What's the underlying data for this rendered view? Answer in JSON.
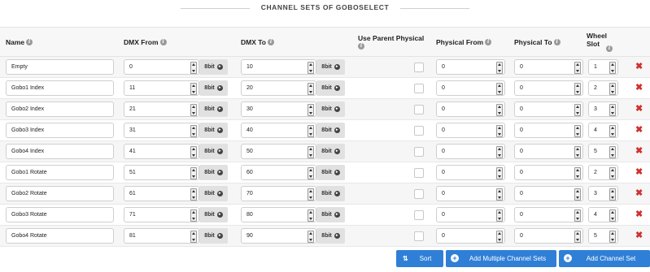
{
  "header": {
    "title": "CHANNEL SETS OF GOBOSELECT"
  },
  "columns": {
    "name": "Name",
    "dmx_from": "DMX From",
    "dmx_to": "DMX To",
    "use_parent_physical": "Use Parent Physical",
    "physical_from": "Physical From",
    "physical_to": "Physical To",
    "wheel_slot": "Wheel Slot"
  },
  "bit_label": "8bit",
  "rows": [
    {
      "name": "Empty",
      "dmx_from": "0",
      "dmx_to": "10",
      "physical_from": "0",
      "physical_to": "0",
      "wheel_slot": "1"
    },
    {
      "name": "Gobo1 Index",
      "dmx_from": "11",
      "dmx_to": "20",
      "physical_from": "0",
      "physical_to": "0",
      "wheel_slot": "2"
    },
    {
      "name": "Gobo2 Index",
      "dmx_from": "21",
      "dmx_to": "30",
      "physical_from": "0",
      "physical_to": "0",
      "wheel_slot": "3"
    },
    {
      "name": "Gobo3 Index",
      "dmx_from": "31",
      "dmx_to": "40",
      "physical_from": "0",
      "physical_to": "0",
      "wheel_slot": "4"
    },
    {
      "name": "Gobo4 Index",
      "dmx_from": "41",
      "dmx_to": "50",
      "physical_from": "0",
      "physical_to": "0",
      "wheel_slot": "5"
    },
    {
      "name": "Gobo1 Rotate",
      "dmx_from": "51",
      "dmx_to": "60",
      "physical_from": "0",
      "physical_to": "0",
      "wheel_slot": "2"
    },
    {
      "name": "Gobo2 Rotate",
      "dmx_from": "61",
      "dmx_to": "70",
      "physical_from": "0",
      "physical_to": "0",
      "wheel_slot": "3"
    },
    {
      "name": "Gobo3 Rotate",
      "dmx_from": "71",
      "dmx_to": "80",
      "physical_from": "0",
      "physical_to": "0",
      "wheel_slot": "4"
    },
    {
      "name": "Gobo4 Rotate",
      "dmx_from": "81",
      "dmx_to": "90",
      "physical_from": "0",
      "physical_to": "0",
      "wheel_slot": "5"
    }
  ],
  "buttons": {
    "sort": "Sort",
    "add_multiple": "Add Multiple Channel Sets",
    "add_one": "Add Channel Set"
  },
  "colors": {
    "primary": "#2f7fd6",
    "delete": "#d0312d"
  },
  "icons": {
    "info": "info-circle-icon",
    "bit": "arrow-circle-right-icon",
    "delete": "delete-x-icon",
    "sort": "sort-icon",
    "add": "plus-circle-icon"
  }
}
